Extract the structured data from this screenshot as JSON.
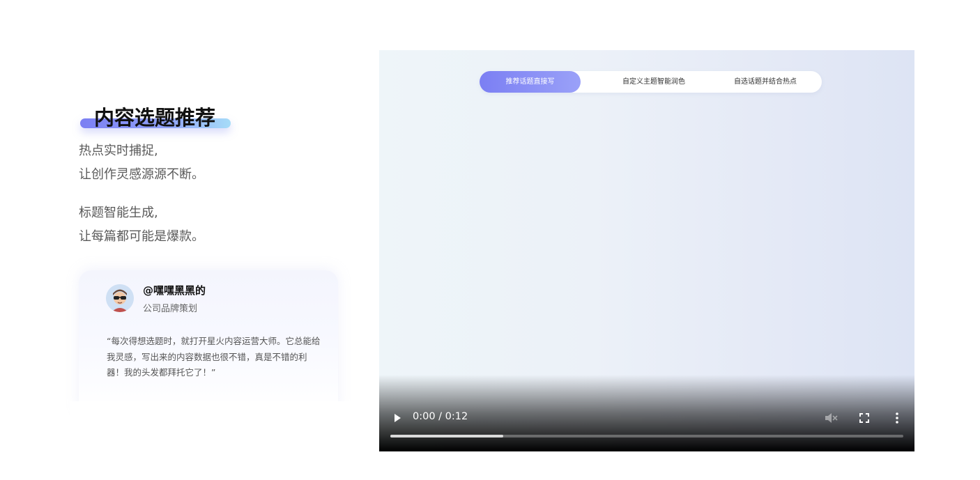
{
  "section": {
    "title": "内容选题推荐",
    "desc1": [
      "热点实时捕捉,",
      "让创作灵感源源不断。"
    ],
    "desc2": [
      "标题智能生成,",
      "让每篇都可能是爆款。"
    ]
  },
  "testimonial": {
    "avatar_icon": "avatar-glasses-icon",
    "username": "@嘿嘿黑黑的",
    "role": "公司品牌策划",
    "quote": "“每次得想选题时，就打开星火内容运营大师。它总能给我灵感，写出来的内容数据也很不错，真是不错的利器！我的头发都拜托它了！”"
  },
  "video": {
    "tabs": [
      {
        "label": "推荐话题直接写",
        "active": true
      },
      {
        "label": "自定义主题智能润色",
        "active": false
      },
      {
        "label": "自选话题并结合热点",
        "active": false
      }
    ],
    "time": "0:00 / 0:12",
    "buffered_fraction": 0.22,
    "icons": {
      "play": "play-icon",
      "mute": "muted-volume-icon",
      "fullscreen": "fullscreen-icon",
      "more": "more-options-icon"
    },
    "colors": {
      "accent_start": "#7b7ff3",
      "accent_end": "#a6dcf8"
    }
  }
}
